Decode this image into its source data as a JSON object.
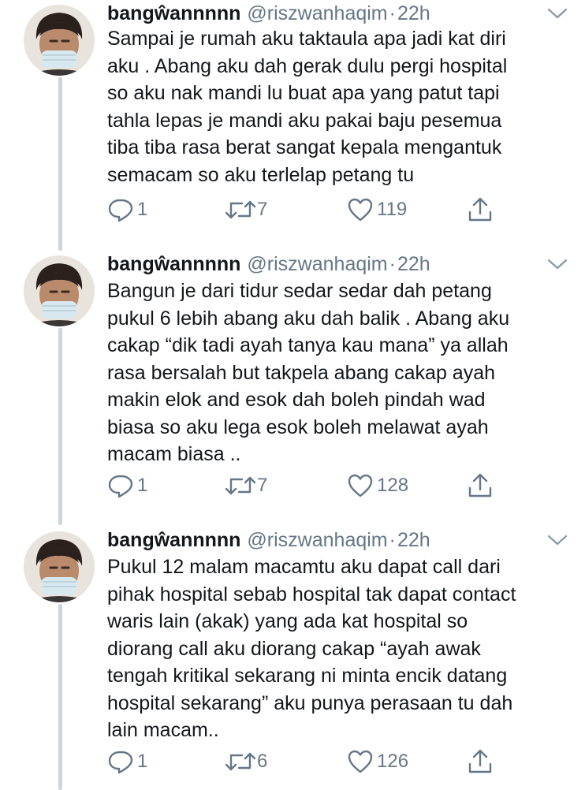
{
  "tweets": [
    {
      "name": "bangŵannnnn",
      "handle": "@riszwanhaqim",
      "separator": "·",
      "time": "22h",
      "lines": [
        "Sampai je rumah aku taktaula apa jadi kat diri",
        "aku . Abang aku dah gerak dulu pergi hospital",
        "so aku nak mandi lu buat apa yang patut tapi",
        "tahla lepas je mandi aku pakai baju pesemua",
        "tiba tiba rasa berat sangat kepala mengantuk",
        "semacam so aku terlelap petang tu"
      ],
      "replies": "1",
      "retweets": "7",
      "likes": "119"
    },
    {
      "name": "bangŵannnnn",
      "handle": "@riszwanhaqim",
      "separator": "·",
      "time": "22h",
      "lines": [
        "Bangun je dari tidur sedar sedar dah petang",
        "pukul 6 lebih abang aku dah balik . Abang aku",
        "cakap “dik tadi ayah tanya kau mana” ya allah",
        "rasa bersalah but takpela abang cakap ayah",
        "makin elok and esok dah boleh pindah wad",
        "biasa so aku lega esok boleh melawat ayah",
        "macam biasa .."
      ],
      "replies": "1",
      "retweets": "7",
      "likes": "128"
    },
    {
      "name": "bangŵannnnn",
      "handle": "@riszwanhaqim",
      "separator": "·",
      "time": "22h",
      "lines": [
        "Pukul 12 malam macamtu aku dapat call dari",
        "pihak hospital sebab hospital tak dapat contact",
        "waris lain (akak) yang ada kat hospital so",
        "diorang call aku diorang cakap “ayah awak",
        "tengah kritikal sekarang ni minta encik datang",
        "hospital sekarang” aku punya perasaan tu dah",
        "lain macam.."
      ],
      "replies": "1",
      "retweets": "6",
      "likes": "126"
    }
  ],
  "colors": {
    "text": "#14171a",
    "secondary": "#657786",
    "thread_line": "#ccd6dd"
  },
  "icons": [
    "reply-icon",
    "retweet-icon",
    "like-icon",
    "share-icon",
    "chevron-down-icon"
  ]
}
